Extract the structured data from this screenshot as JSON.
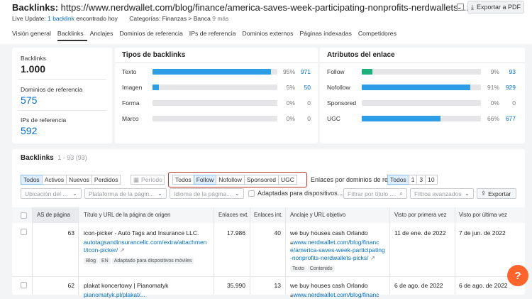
{
  "header": {
    "title_prefix": "Backlinks:",
    "title_url": "https://www.nerdwallet.com/blog/finance/america-saves-week-participating-nonprofits-nerdwallets-...",
    "export_pdf": "Exportar a PDF",
    "live_update_label": "Live Update:",
    "live_update_link": "1 backlink",
    "live_update_suffix": "encontrado hoy",
    "categories_label": "Categorías: Finanzas > Banca",
    "categories_more": "9 más"
  },
  "tabs": [
    "Visión general",
    "Backlinks",
    "Anclajes",
    "Dominios de referencia",
    "IPs de referencia",
    "Dominios externos",
    "Páginas indexadas",
    "Competidores"
  ],
  "metrics": {
    "backlinks_label": "Backlinks",
    "backlinks_value": "1.000",
    "domains_label": "Dominios de referencia",
    "domains_value": "575",
    "ips_label": "IPs de referencia",
    "ips_value": "592"
  },
  "types": {
    "title": "Tipos de backlinks",
    "rows": [
      {
        "label": "Texto",
        "pct": "95%",
        "pct_value": 95,
        "count": "971"
      },
      {
        "label": "Imagen",
        "pct": "5%",
        "pct_value": 5,
        "count": "50"
      },
      {
        "label": "Forma",
        "pct": "0%",
        "pct_value": 0,
        "count": "0"
      },
      {
        "label": "Marco",
        "pct": "0%",
        "pct_value": 0,
        "count": "0"
      }
    ]
  },
  "attributes": {
    "title": "Atributos del enlace",
    "rows": [
      {
        "label": "Follow",
        "pct": "9%",
        "pct_value": 9,
        "count": "93",
        "color": "#1db07d"
      },
      {
        "label": "Nofollow",
        "pct": "91%",
        "pct_value": 91,
        "count": "929",
        "color": "#2d9de6"
      },
      {
        "label": "Sponsored",
        "pct": "0%",
        "pct_value": 0,
        "count": "0",
        "color": "#2d9de6"
      },
      {
        "label": "UGC",
        "pct": "66%",
        "pct_value": 66,
        "count": "677",
        "color": "#2d9de6"
      }
    ]
  },
  "colors": {
    "bar_blue": "#2d9de6",
    "highlight_border": "#c0392b",
    "help_orange": "#ff642d"
  },
  "table_section": {
    "title": "Backlinks",
    "range": "1 - 93 (93)",
    "filter1": [
      "Todos",
      "Activos",
      "Nuevos",
      "Perdidos"
    ],
    "period": "Período",
    "filter2": [
      "Todos",
      "Follow",
      "Nofollow",
      "Sponsored",
      "UGC"
    ],
    "per_domain_label": "Enlaces por dominios de ref.",
    "per_domain": [
      "Todos",
      "1",
      "3",
      "10"
    ],
    "dd_url_placeholder": "Ubicación del ...",
    "dd_platform_placeholder": "Plataforma de la págin...",
    "dd_language_placeholder": "Idioma de la página...",
    "mobile_label": "Adaptadas para dispositivos...",
    "search_placeholder": "Filtrar por título ...",
    "adv_filters": "Filtros avanzados",
    "export": "Exportar"
  },
  "columns": [
    "AS de página",
    "Título y URL de la página de origen",
    "Enlaces ext.",
    "Enlaces int.",
    "Anclaje y URL objetivo",
    "Visto por primera vez",
    "Visto por última vez"
  ],
  "rows": [
    {
      "as": "63",
      "title": "icon-picker - Auto Tags and Insurance LLC.",
      "url": "autotagsandinsurancellc.com/extra/attachment/icon-picker/",
      "url_l1": "autotagsandinsurancellc.com/extra/attachmen",
      "url_l2": "t/icon-picker/",
      "tags": [
        "Blog",
        "EN",
        "Adaptado para dispositivos móviles"
      ],
      "ext": "17.986",
      "int": "40",
      "anchor": "we buy houses cash Orlando",
      "target_l1": "www.nerdwallet.com/blog/financ",
      "target_l2": "e/america-saves-week-participating",
      "target_l3": "-nonprofits-nerdwallets-picks/",
      "anchor_tags": [
        "Texto",
        "Contenido"
      ],
      "first": "11 de ene. de 2022",
      "last": "7 de jun. de 2022"
    },
    {
      "as": "62",
      "title": "plakat koncertowy | Pianomatyk",
      "url_l1": "pianomatyk.pl/plakat/...",
      "ext": "35.990",
      "int": "13",
      "anchor": "we buy houses cash Orlando",
      "target_l1": "www.nerdwallet.com/blog/financ",
      "first": "6 de ago. de 2022",
      "last": "6 de ago. de 2022"
    }
  ]
}
